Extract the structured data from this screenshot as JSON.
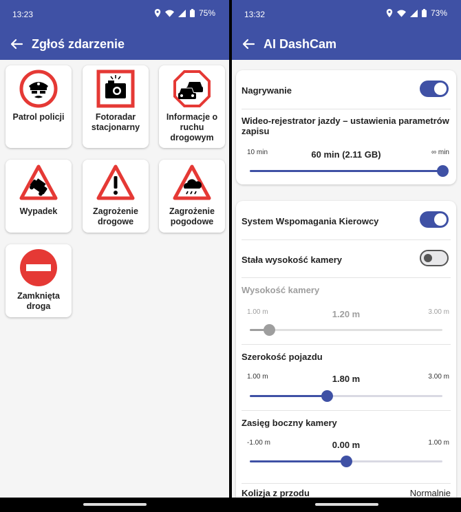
{
  "left": {
    "status": {
      "time": "13:23",
      "battery": "75%"
    },
    "title": "Zgłoś zdarzenie",
    "tiles": [
      {
        "label": "Patrol policji",
        "icon": "police-officer-icon"
      },
      {
        "label": "Fotoradar stacjonarny",
        "icon": "speed-camera-icon"
      },
      {
        "label": "Informacje o ruchu drogowym",
        "icon": "traffic-info-icon"
      },
      {
        "label": "Wypadek",
        "icon": "accident-icon"
      },
      {
        "label": "Zagrożenie drogowe",
        "icon": "road-hazard-icon"
      },
      {
        "label": "Zagrożenie pogodowe",
        "icon": "weather-hazard-icon"
      },
      {
        "label": "Zamknięta droga",
        "icon": "road-closed-icon"
      }
    ]
  },
  "right": {
    "status": {
      "time": "13:32",
      "battery": "73%"
    },
    "title": "AI DashCam",
    "recording": {
      "label": "Nagrywanie",
      "toggle_on": true,
      "desc": "Wideo-rejestrator jazdy – ustawienia parametrów zapisu",
      "slider": {
        "min": "10 min",
        "value": "60 min (2.11 GB)",
        "max": "∞ min",
        "fraction": 1.0
      }
    },
    "assist": {
      "label": "System Wspomagania Kierowcy",
      "toggle_on": true,
      "fixed_height": {
        "label": "Stała wysokość kamery",
        "toggle_on": false
      },
      "camera_height": {
        "label": "Wysokość kamery",
        "min": "1.00 m",
        "value": "1.20 m",
        "max": "3.00 m",
        "fraction": 0.1,
        "enabled": false
      },
      "vehicle_width": {
        "label": "Szerokość pojazdu",
        "min": "1.00 m",
        "value": "1.80 m",
        "max": "3.00 m",
        "fraction": 0.4,
        "enabled": true
      },
      "side_range": {
        "label": "Zasięg boczny kamery",
        "min": "-1.00 m",
        "value": "0.00 m",
        "max": "1.00 m",
        "fraction": 0.5,
        "enabled": true
      },
      "collision": {
        "label": "Kolizja z przodu",
        "value": "Normalnie"
      }
    }
  },
  "colors": {
    "primary": "#3f51a5",
    "sign_red": "#e53935",
    "background": "#f5f5f5"
  }
}
